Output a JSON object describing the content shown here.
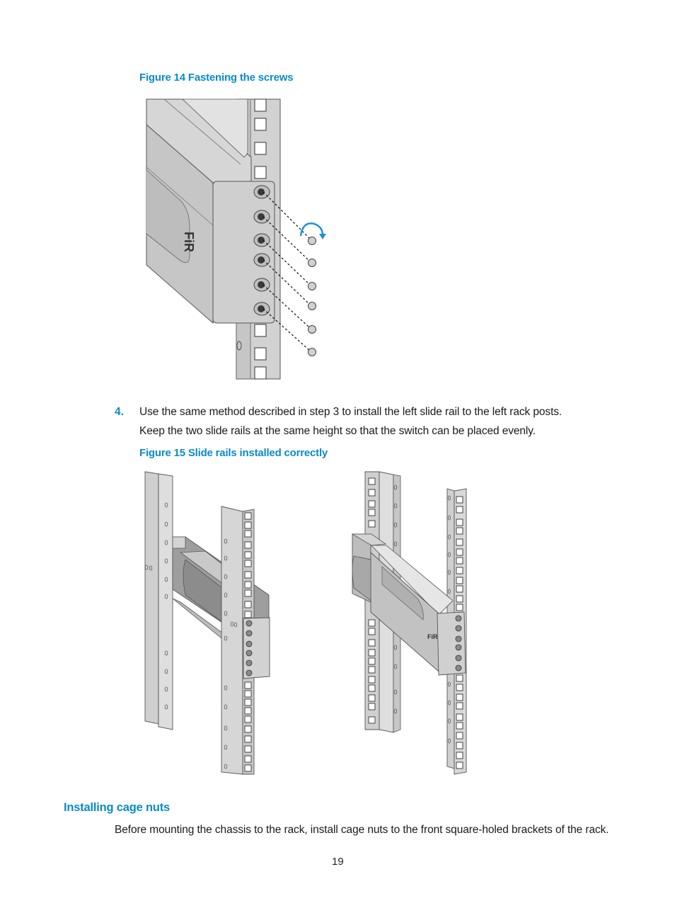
{
  "figures": [
    {
      "caption": "Figure 14 Fastening the screws",
      "illustration": "rack-mounting-screws-illustration",
      "screw_count": 6,
      "rotation_arrow_color": "#1e90d8",
      "logo_text": "FiR"
    },
    {
      "caption": "Figure 15 Slide rails installed correctly",
      "illustration": "slide-rails-installed-illustration",
      "panels": [
        "slide-rails-without-chassis",
        "slide-rails-with-chassis"
      ]
    }
  ],
  "steps": [
    {
      "number": "4.",
      "lines": [
        "Use the same method described in step 3 to install the left slide rail to the left rack posts.",
        "Keep the two slide rails at the same height so that the switch can be placed evenly."
      ]
    }
  ],
  "section": {
    "heading": "Installing cage nuts",
    "paragraph": "Before mounting the chassis to the rack, install cage nuts to the front square-holed brackets of the rack."
  },
  "page_number": "19",
  "colors": {
    "accent": "#0a8bc8",
    "metal_light": "#dcdcdc",
    "metal_mid": "#c4c4c4",
    "metal_dark": "#9a9a9a"
  }
}
